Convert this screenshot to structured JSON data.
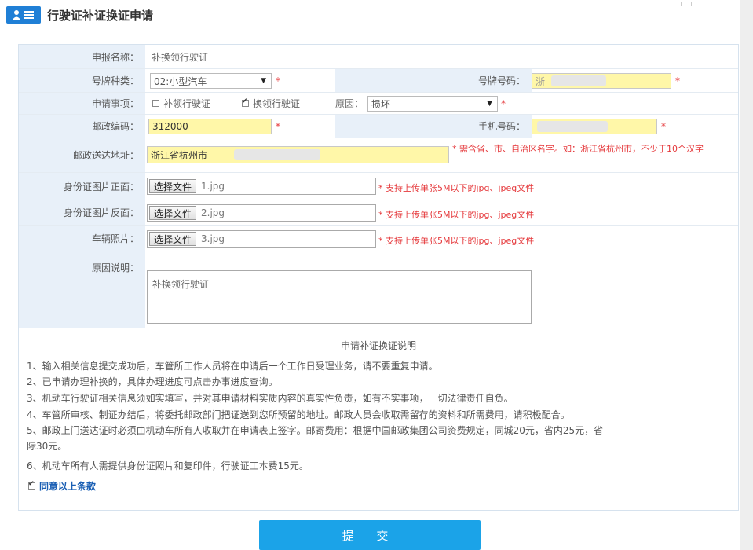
{
  "header": {
    "title": "行驶证补证换证申请",
    "icon": "user-list-icon"
  },
  "form": {
    "apply_name": {
      "label": "申报名称：",
      "value": "补换领行驶证"
    },
    "plate_type": {
      "label": "号牌种类：",
      "value": "02:小型汽车"
    },
    "plate_number": {
      "label": "号牌号码：",
      "prefix": "浙"
    },
    "apply_item": {
      "label": "申请事项：",
      "options": [
        {
          "label": "补领行驶证",
          "checked": false
        },
        {
          "label": "换领行驶证",
          "checked": true
        }
      ],
      "reason_label": "原因：",
      "reason_value": "损坏"
    },
    "postcode": {
      "label": "邮政编码：",
      "value": "312000"
    },
    "phone": {
      "label": "手机号码："
    },
    "address": {
      "label": "邮政送达地址：",
      "value": "浙江省杭州市",
      "hint": "* 需含省、市、自治区名字。如：浙江省杭州市，不少于10个汉字"
    },
    "id_front": {
      "label": "身份证图片正面：",
      "button": "选择文件",
      "file": "1.jpg",
      "hint": "* 支持上传单张5M以下的jpg、jpeg文件"
    },
    "id_back": {
      "label": "身份证图片反面：",
      "button": "选择文件",
      "file": "2.jpg",
      "hint": "* 支持上传单张5M以下的jpg、jpeg文件"
    },
    "vehicle_photo": {
      "label": "车辆照片：",
      "button": "选择文件",
      "file": "3.jpg",
      "hint": "* 支持上传单张5M以下的jpg、jpeg文件"
    },
    "reason_desc": {
      "label": "原因说明：",
      "value": "补换领行驶证"
    },
    "required_mark": "*"
  },
  "notes": {
    "title": "申请补证换证说明",
    "items": [
      "1、输入相关信息提交成功后，车管所工作人员将在申请后一个工作日受理业务，请不要重复申请。",
      "2、已申请办理补换的，具体办理进度可点击办事进度查询。",
      "3、机动车行驶证相关信息须如实填写，并对其申请材料实质内容的真实性负责，如有不实事项，一切法律责任自负。",
      "4、车管所审核、制证办结后，将委托邮政部门把证送到您所预留的地址。邮政人员会收取需留存的资料和所需费用，请积极配合。",
      "5、邮政上门送达证时必须由机动车所有人收取并在申请表上签字。邮寄费用：根据中国邮政集团公司资费规定，同城20元，省内25元，省",
      "际30元。",
      "6、机动车所有人需提供身份证照片和复印件，行驶证工本费15元。"
    ],
    "agree": "同意以上条款"
  },
  "submit_label": "提 交",
  "colors": {
    "accent": "#1ba3e8",
    "label_bg": "#e8f0f9",
    "required": "#e5383b",
    "input_highlight": "#fff7a8"
  }
}
